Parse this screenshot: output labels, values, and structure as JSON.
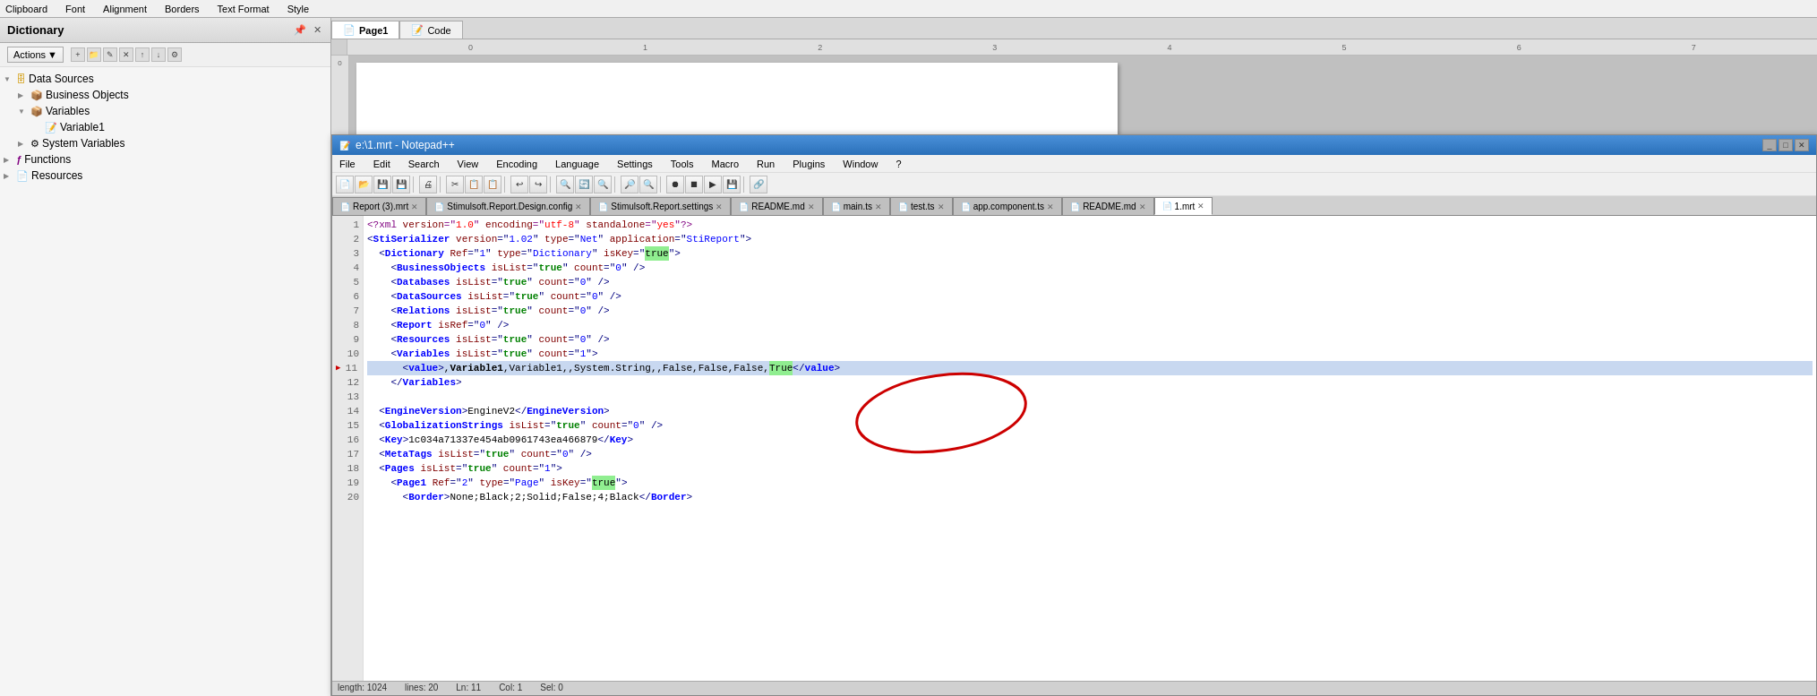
{
  "topbar": {
    "sections": [
      "Clipboard",
      "Font",
      "Alignment",
      "Borders",
      "Text Format",
      "Style"
    ]
  },
  "dictionary": {
    "title": "Dictionary",
    "pin_icon": "📌",
    "close_icon": "✕",
    "actions_label": "Actions",
    "actions_dropdown": "▼",
    "tree": [
      {
        "level": 0,
        "expand": "▼",
        "icon": "📁",
        "label": "Data Sources",
        "type": "folder"
      },
      {
        "level": 1,
        "expand": "▶",
        "icon": "📦",
        "label": "Business Objects",
        "type": "folder"
      },
      {
        "level": 1,
        "expand": "▼",
        "icon": "📦",
        "label": "Variables",
        "type": "folder"
      },
      {
        "level": 2,
        "expand": "",
        "icon": "📝",
        "label": "Variable1",
        "type": "item"
      },
      {
        "level": 1,
        "expand": "▶",
        "icon": "⚙",
        "label": "System Variables",
        "type": "folder"
      },
      {
        "level": 0,
        "expand": "▶",
        "icon": "ƒ",
        "label": "Functions",
        "type": "folder"
      },
      {
        "level": 0,
        "expand": "▶",
        "icon": "📄",
        "label": "Resources",
        "type": "folder"
      }
    ]
  },
  "designer": {
    "tabs": [
      {
        "label": "Page1",
        "icon": "📄",
        "active": true
      },
      {
        "label": "Code",
        "icon": "📝",
        "active": false
      }
    ],
    "ruler_marks": [
      "0",
      "1",
      "2",
      "3",
      "4",
      "5",
      "6",
      "7"
    ]
  },
  "notepad": {
    "title": "e:\\1.mrt - Notepad++",
    "icon": "📝",
    "menus": [
      "File",
      "Edit",
      "Search",
      "View",
      "Encoding",
      "Language",
      "Settings",
      "Tools",
      "Macro",
      "Run",
      "Plugins",
      "Window",
      "?"
    ],
    "tabs": [
      {
        "label": "Report (3).mrt",
        "active": false,
        "has_close": true
      },
      {
        "label": "Stimulsoft.Report.Design.config",
        "active": false,
        "has_close": true
      },
      {
        "label": "Stimulsoft.Report.settings",
        "active": false,
        "has_close": true
      },
      {
        "label": "README.md",
        "active": false,
        "has_close": true
      },
      {
        "label": "main.ts",
        "active": false,
        "has_close": true
      },
      {
        "label": "test.ts",
        "active": false,
        "has_close": true
      },
      {
        "label": "app.component.ts",
        "active": false,
        "has_close": true
      },
      {
        "label": "README.md",
        "active": false,
        "has_close": true
      },
      {
        "label": "1.mrt",
        "active": true,
        "has_close": true
      }
    ],
    "lines": [
      {
        "num": 1,
        "content": "<?xml version=\"1.0\" encoding=\"utf-8\" standalone=\"yes\"?>",
        "type": "pi"
      },
      {
        "num": 2,
        "content": "<StiSerializer version=\"1.02\" type=\"Net\" application=\"StiReport\">",
        "type": "tag"
      },
      {
        "num": 3,
        "content": "  <Dictionary Ref=\"1\" type=\"Dictionary\" isKey=\"true\">",
        "type": "tag"
      },
      {
        "num": 4,
        "content": "    <BusinessObjects isList=\"true\" count=\"0\" />",
        "type": "tag"
      },
      {
        "num": 5,
        "content": "    <Databases isList=\"true\" count=\"0\" />",
        "type": "tag"
      },
      {
        "num": 6,
        "content": "    <DataSources isList=\"true\" count=\"0\" />",
        "type": "tag"
      },
      {
        "num": 7,
        "content": "    <Relations isList=\"true\" count=\"0\" />",
        "type": "tag"
      },
      {
        "num": 8,
        "content": "    <Report isRef=\"0\" />",
        "type": "tag"
      },
      {
        "num": 9,
        "content": "    <Resources isList=\"true\" count=\"0\" />",
        "type": "tag"
      },
      {
        "num": 10,
        "content": "    <Variables isList=\"true\" count=\"1\">",
        "type": "tag"
      },
      {
        "num": 11,
        "content": "      <value>,Variable1,Variable1,,System.String,,False,False,False,True</value>",
        "type": "value",
        "highlighted": true,
        "has_marker": true
      },
      {
        "num": 12,
        "content": "    </Variables>",
        "type": "tag"
      },
      {
        "num": 13,
        "content": "",
        "type": "empty"
      },
      {
        "num": 14,
        "content": "  <EngineVersion>EngineV2</EngineVersion>",
        "type": "tag"
      },
      {
        "num": 15,
        "content": "  <GlobalizationStrings isList=\"true\" count=\"0\" />",
        "type": "tag"
      },
      {
        "num": 16,
        "content": "  <Key>1c034a71337e454ab0961743ea466879</Key>",
        "type": "tag"
      },
      {
        "num": 17,
        "content": "  <MetaTags isList=\"true\" count=\"0\" />",
        "type": "tag"
      },
      {
        "num": 18,
        "content": "  <Pages isList=\"true\" count=\"1\">",
        "type": "tag"
      },
      {
        "num": 19,
        "content": "    <Page1 Ref=\"2\" type=\"Page\" isKey=\"true\">",
        "type": "tag"
      },
      {
        "num": 20,
        "content": "      <Border>None;Black;2;Solid;False;4;Black</Border>",
        "type": "tag"
      }
    ]
  }
}
